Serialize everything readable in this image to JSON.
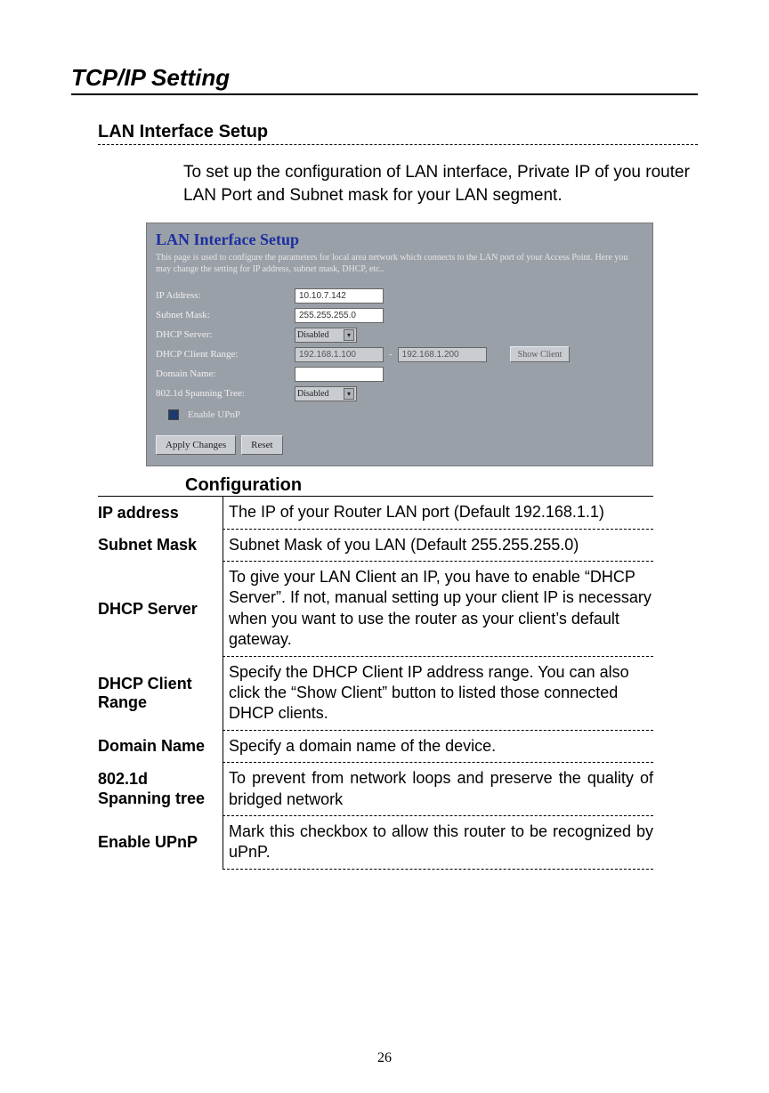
{
  "page_number": "26",
  "h1": "TCP/IP Setting",
  "h2": "LAN Interface Setup",
  "intro": "To set up the configuration of LAN interface, Private IP of you router LAN Port and Subnet mask for your LAN segment.",
  "panel": {
    "title": "LAN Interface Setup",
    "desc": "This page is used to configure the parameters for local area network which connects to the LAN port of your Access Point. Here you may change the setting for IP address, subnet mask, DHCP, etc..",
    "labels": {
      "ip": "IP Address:",
      "mask": "Subnet Mask:",
      "dhcp": "DHCP Server:",
      "range": "DHCP Client Range:",
      "domain": "Domain Name:",
      "spanning": "802.1d Spanning Tree:",
      "upnp": "Enable UPnP"
    },
    "values": {
      "ip": "10.10.7.142",
      "mask": "255.255.255.0",
      "dhcp": "Disabled",
      "range_from": "192.168.1.100",
      "range_to": "192.168.1.200",
      "domain": "",
      "spanning": "Disabled"
    },
    "range_sep": "-",
    "buttons": {
      "show_client": "Show Client",
      "apply": "Apply Changes",
      "reset": "Reset"
    }
  },
  "h3": "Configuration",
  "config_rows": [
    {
      "label": "IP address",
      "value": "The IP of your Router LAN port (Default 192.168.1.1)"
    },
    {
      "label": "Subnet Mask",
      "value": "Subnet Mask of you LAN (Default 255.255.255.0)"
    },
    {
      "label": "DHCP  Server",
      "value": "To give your LAN Client an IP, you have to enable “DHCP Server”. If not, manual setting up your client IP is necessary when you want to use the router as your client’s default gateway."
    },
    {
      "label": "DHCP  Client Range",
      "value": "Specify the DHCP Client IP address range. You can also click the “Show Client” button to listed those connected DHCP clients."
    },
    {
      "label": "Domain  Name",
      "value": "Specify a domain name of the device."
    },
    {
      "label": "802.1d Spanning tree",
      "value": "To prevent from network loops and preserve the quality of bridged network",
      "justify": true
    },
    {
      "label": "Enable  UPnP",
      "value": "Mark this checkbox to allow this router to be recognized by uPnP.",
      "justify": true
    }
  ]
}
